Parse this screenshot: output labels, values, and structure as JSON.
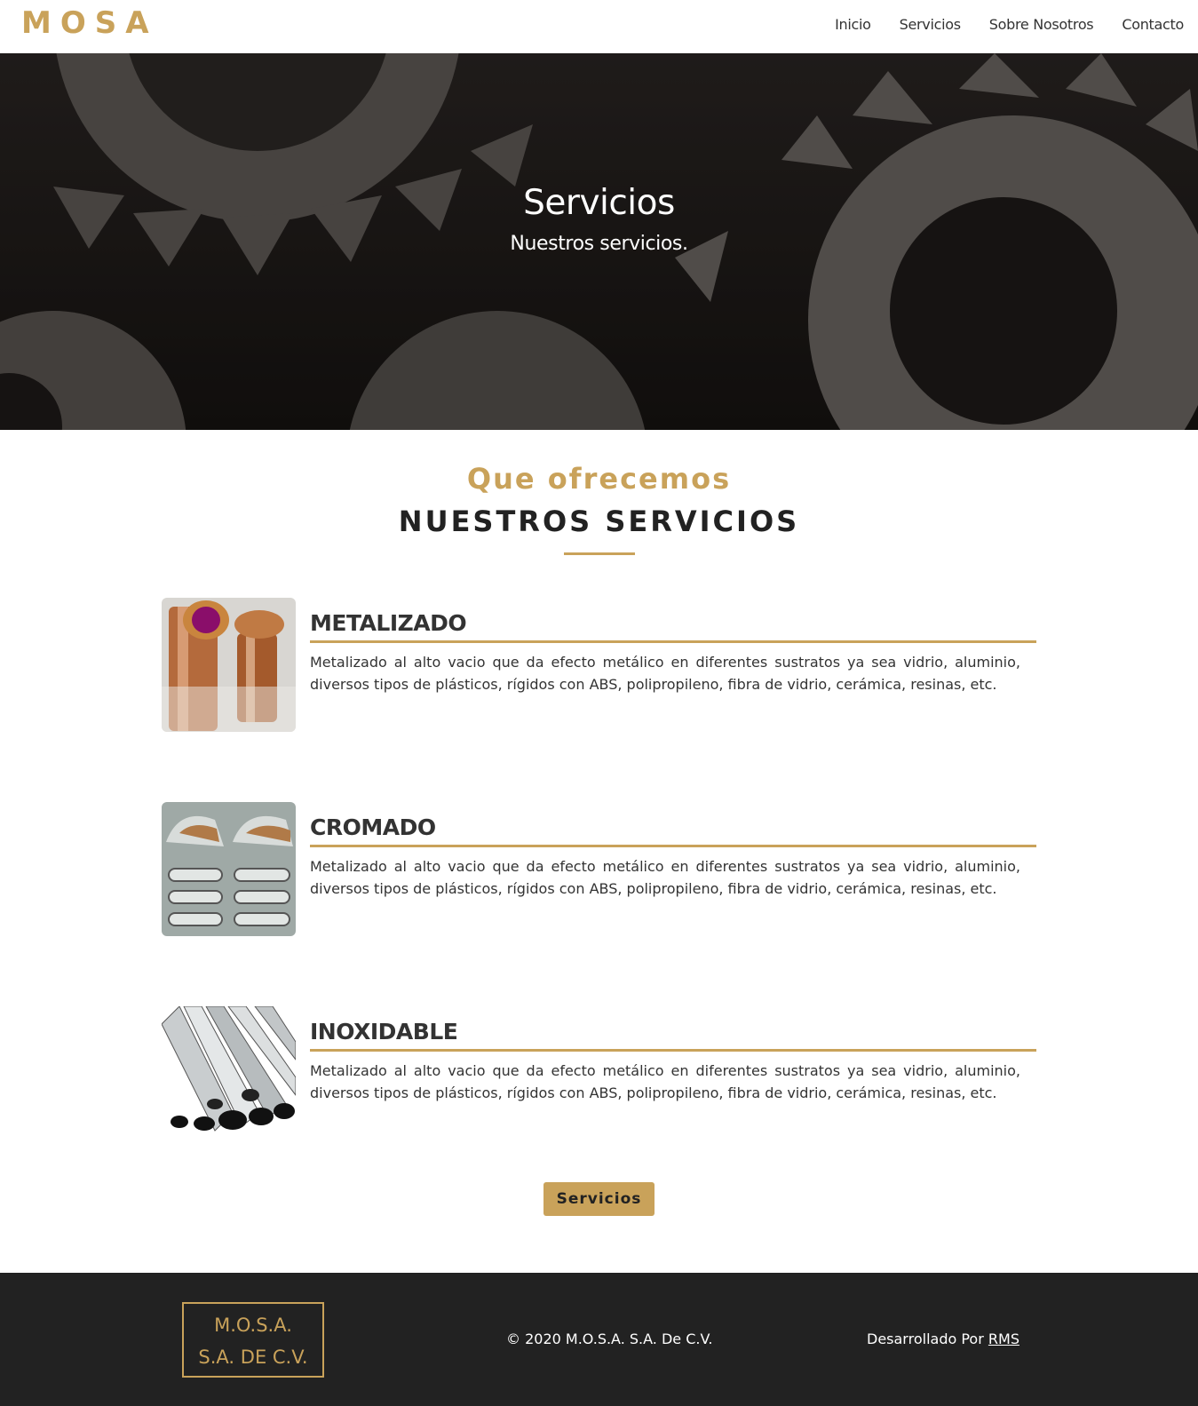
{
  "brand": "MOSA",
  "nav": {
    "items": [
      "Inicio",
      "Servicios",
      "Sobre Nosotros",
      "Contacto"
    ]
  },
  "hero": {
    "title": "Servicios",
    "subtitle": "Nuestros servicios."
  },
  "section": {
    "kicker": "Que ofrecemos",
    "title": "NUESTROS SERVICIOS"
  },
  "services": [
    {
      "title": "METALIZADO",
      "description": "Metalizado al alto vacio que da efecto metálico en diferentes sustratos ya sea vidrio, aluminio, diversos tipos de plásticos, rígidos con ABS, polipropileno, fibra de vidrio, cerámica, resinas, etc."
    },
    {
      "title": "CROMADO",
      "description": "Metalizado al alto vacio que da efecto metálico en diferentes sustratos ya sea vidrio, aluminio, diversos tipos de plásticos, rígidos con ABS, polipropileno, fibra de vidrio, cerámica, resinas, etc."
    },
    {
      "title": "INOXIDABLE",
      "description": "Metalizado al alto vacio que da efecto metálico en diferentes sustratos ya sea vidrio, aluminio, diversos tipos de plásticos, rígidos con ABS, polipropileno, fibra de vidrio, cerámica, resinas, etc."
    }
  ],
  "button": {
    "label": "Servicios"
  },
  "footer": {
    "logo_line1": "M.O.S.A.",
    "logo_line2": "S.A. DE C.V.",
    "copyright": "© 2020 M.O.S.A. S.A. De C.V.",
    "developed_by": "Desarrollado Por",
    "developer": "RMS"
  },
  "colors": {
    "accent": "#c9a25a",
    "footer_bg": "#222222",
    "text": "#333333"
  }
}
